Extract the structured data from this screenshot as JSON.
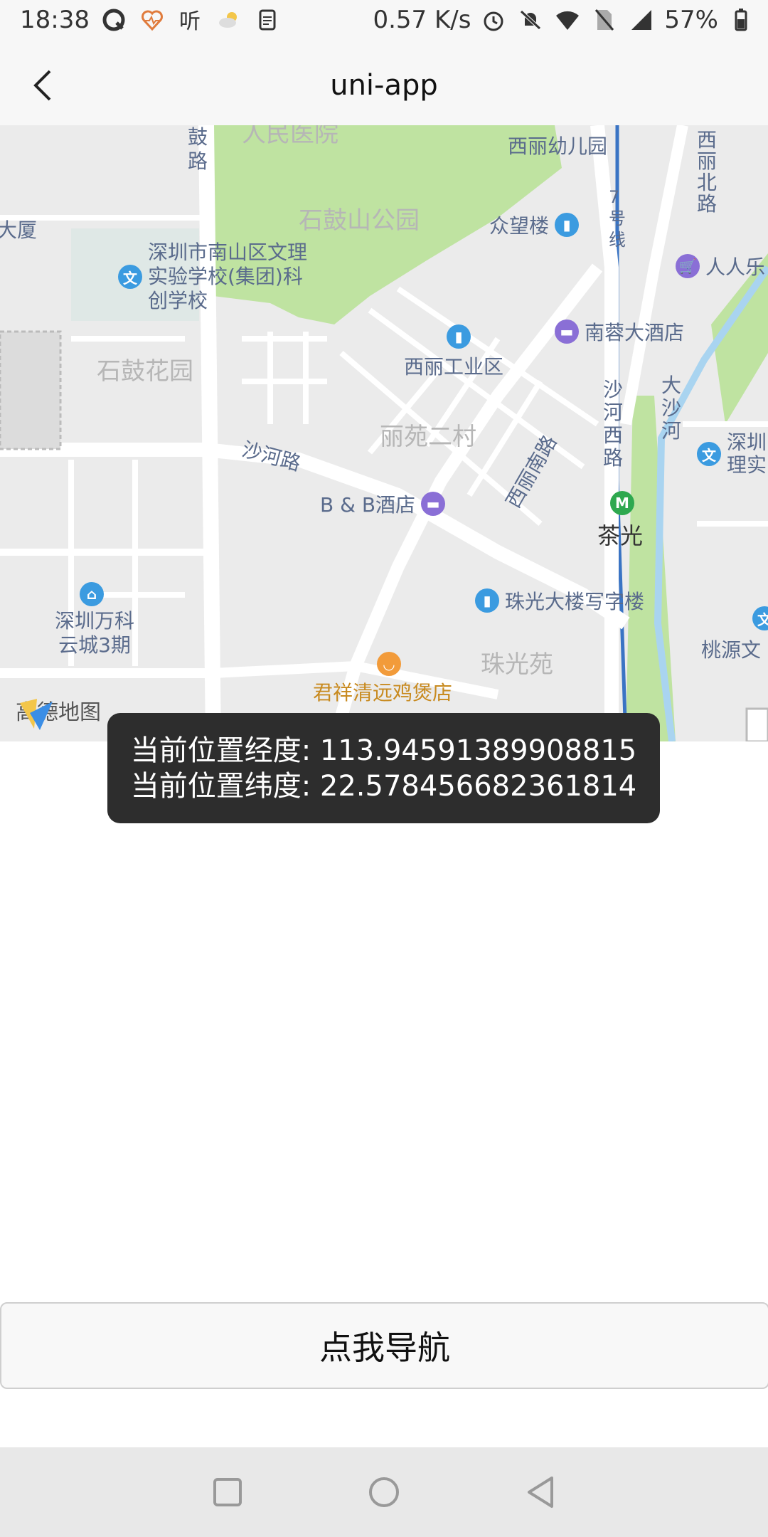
{
  "status_bar": {
    "time": "18:38",
    "network_speed": "0.57 K/s",
    "battery": "57%"
  },
  "navbar": {
    "title": "uni-app"
  },
  "map": {
    "labels": {
      "hospital": "人民医院",
      "gu_road": "鼓路",
      "xili_kindergarten": "西丽幼儿园",
      "xili_north_road": "西丽北路",
      "shigu_park": "石鼓山公园",
      "zhongwang": "众望楼",
      "dasha_left": "大厦",
      "school": "深圳市南山区文理实验学校(集团)科创学校",
      "line7": "7号线",
      "renrenle": "人人乐",
      "nanrong_hotel": "南蓉大酒店",
      "shigu_garden": "石鼓花园",
      "xili_industrial": "西丽工业区",
      "dasha_river": "大沙河",
      "shahe_road": "沙河路",
      "liyuan_ercun": "丽苑二村",
      "shahe_west": "沙河西路",
      "xili_nan_road": "西丽南路",
      "shenzhen_right": "深圳理实",
      "bb_hotel": "B & B酒店",
      "chaguang": "茶光",
      "zhuguang_building": "珠光大楼写字楼",
      "vanke": "深圳万科云城3期",
      "zhuguang_yuan": "珠光苑",
      "taoyuan": "桃源文",
      "junxiang": "君祥清远鸡煲店",
      "amap": "高德地图"
    }
  },
  "toast": {
    "longitude_line": "当前位置经度:  113.94591389908815",
    "latitude_line": "当前位置纬度: 22.578456682361814"
  },
  "button": {
    "label": "点我导航"
  }
}
